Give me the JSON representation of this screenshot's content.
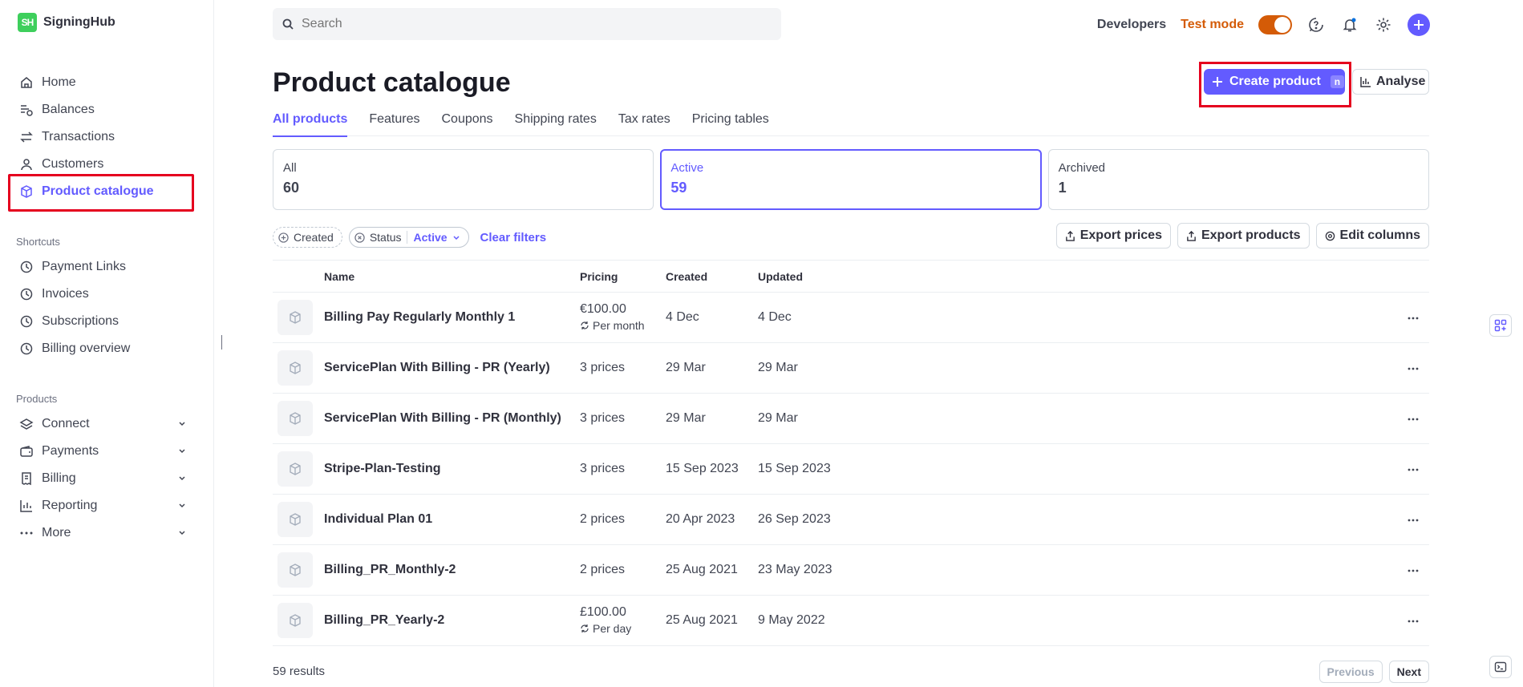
{
  "brand": {
    "logo": "SH",
    "name": "SigningHub",
    "accent": "#635bff"
  },
  "sidebar": {
    "main_items": [
      {
        "label": "Home",
        "icon": "home-icon"
      },
      {
        "label": "Balances",
        "icon": "balances-icon"
      },
      {
        "label": "Transactions",
        "icon": "transactions-icon"
      },
      {
        "label": "Customers",
        "icon": "customers-icon"
      },
      {
        "label": "Product catalogue",
        "icon": "product-box-icon",
        "active": true
      }
    ],
    "shortcuts_label": "Shortcuts",
    "shortcuts": [
      {
        "label": "Payment Links",
        "icon": "clock-icon"
      },
      {
        "label": "Invoices",
        "icon": "clock-icon"
      },
      {
        "label": "Subscriptions",
        "icon": "clock-icon"
      },
      {
        "label": "Billing overview",
        "icon": "clock-icon"
      }
    ],
    "products_label": "Products",
    "products": [
      {
        "label": "Connect",
        "icon": "connect-icon"
      },
      {
        "label": "Payments",
        "icon": "wallet-icon"
      },
      {
        "label": "Billing",
        "icon": "billing-icon"
      },
      {
        "label": "Reporting",
        "icon": "reporting-icon"
      },
      {
        "label": "More",
        "icon": "more-dots-icon"
      }
    ]
  },
  "topbar": {
    "search_placeholder": "Search",
    "developers": "Developers",
    "test_mode": "Test mode",
    "test_mode_color": "#d45b07"
  },
  "page": {
    "title": "Product catalogue",
    "create_label": "Create product",
    "create_shortcut": "n",
    "analyse_label": "Analyse"
  },
  "tabs": [
    "All products",
    "Features",
    "Coupons",
    "Shipping rates",
    "Tax rates",
    "Pricing tables"
  ],
  "cards": [
    {
      "label": "All",
      "count": "60"
    },
    {
      "label": "Active",
      "count": "59"
    },
    {
      "label": "Archived",
      "count": "1"
    }
  ],
  "filters": {
    "created": "Created",
    "status": "Status",
    "status_value": "Active",
    "clear": "Clear filters"
  },
  "actions": {
    "export_prices": "Export prices",
    "export_products": "Export products",
    "edit_columns": "Edit columns"
  },
  "table": {
    "headers": [
      "Name",
      "Pricing",
      "Created",
      "Updated"
    ],
    "rows": [
      {
        "name": "Billing Pay Regularly Monthly 1",
        "pricing": "€100.00",
        "pricing_sub": "Per month",
        "created": "4 Dec",
        "updated": "4 Dec"
      },
      {
        "name": "ServicePlan With Billing - PR (Yearly)",
        "pricing": "3 prices",
        "pricing_sub": "",
        "created": "29 Mar",
        "updated": "29 Mar"
      },
      {
        "name": "ServicePlan With Billing - PR (Monthly)",
        "pricing": "3 prices",
        "pricing_sub": "",
        "created": "29 Mar",
        "updated": "29 Mar"
      },
      {
        "name": "Stripe-Plan-Testing",
        "pricing": "3 prices",
        "pricing_sub": "",
        "created": "15 Sep 2023",
        "updated": "15 Sep 2023"
      },
      {
        "name": "Individual Plan 01",
        "pricing": "2 prices",
        "pricing_sub": "",
        "created": "20 Apr 2023",
        "updated": "26 Sep 2023"
      },
      {
        "name": "Billing_PR_Monthly-2",
        "pricing": "2 prices",
        "pricing_sub": "",
        "created": "25 Aug 2021",
        "updated": "23 May 2023"
      },
      {
        "name": "Billing_PR_Yearly-2",
        "pricing": "£100.00",
        "pricing_sub": "Per day",
        "created": "25 Aug 2021",
        "updated": "9 May 2022"
      }
    ]
  },
  "footer": {
    "results": "59 results",
    "previous": "Previous",
    "next": "Next"
  }
}
